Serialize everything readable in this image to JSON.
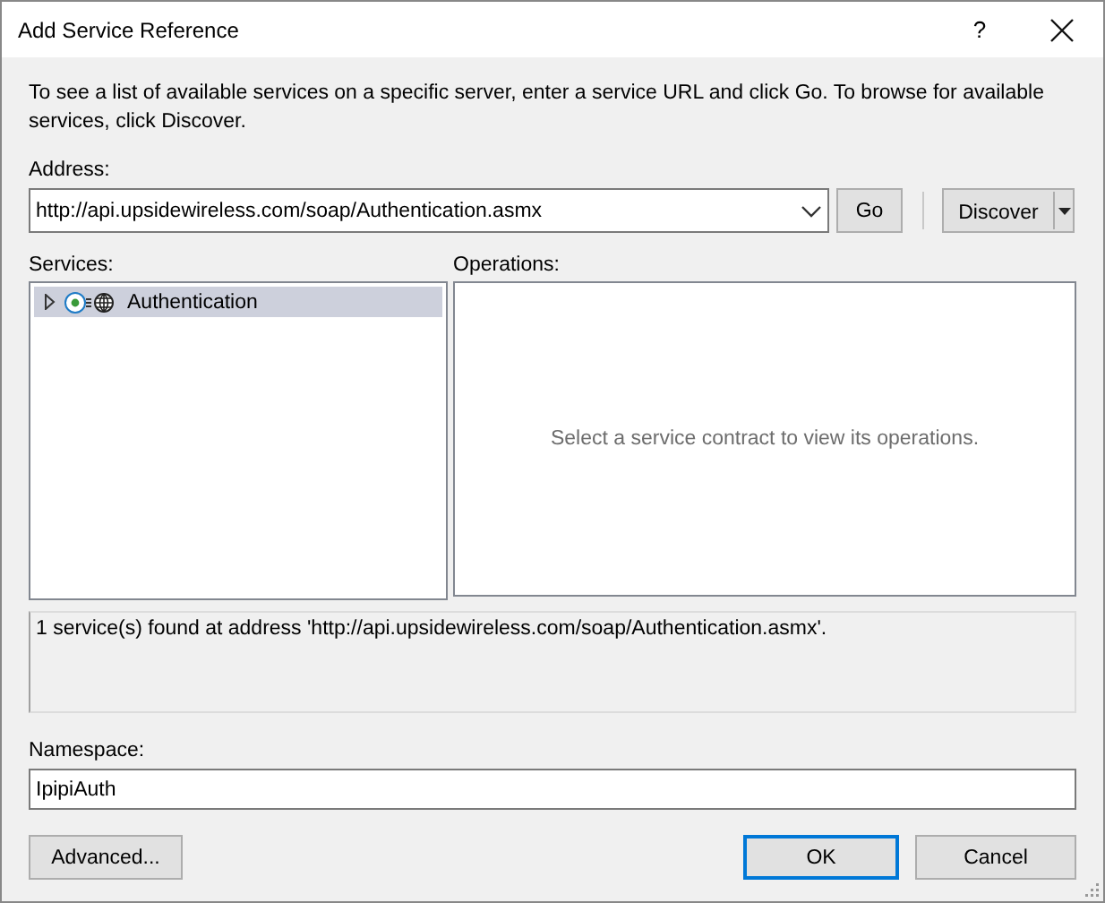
{
  "window": {
    "title": "Add Service Reference",
    "help": "?"
  },
  "description": "To see a list of available services on a specific server, enter a service URL and click Go. To browse for available services, click Discover.",
  "address": {
    "label": "Address:",
    "value": "http://api.upsidewireless.com/soap/Authentication.asmx"
  },
  "go_button": "Go",
  "discover_button": "Discover",
  "services": {
    "label": "Services:",
    "items": [
      {
        "label": "Authentication",
        "expanded": false,
        "selected": true
      }
    ]
  },
  "operations": {
    "label": "Operations:",
    "message": "Select a service contract to view its operations."
  },
  "status": "1 service(s) found at address 'http://api.upsidewireless.com/soap/Authentication.asmx'.",
  "namespace": {
    "label": "Namespace:",
    "value": "IpipiAuth"
  },
  "buttons": [
    {
      "label": "Advanced...",
      "kind": "plain",
      "default": false
    },
    {
      "label": "OK",
      "kind": "action",
      "default": true
    },
    {
      "label": "Cancel",
      "kind": "action",
      "default": false
    }
  ]
}
